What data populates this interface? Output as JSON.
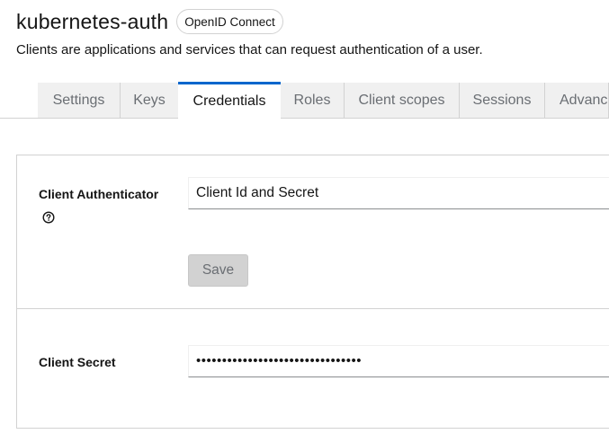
{
  "header": {
    "client_name": "kubernetes-auth",
    "protocol_badge": "OpenID Connect",
    "subtitle": "Clients are applications and services that can request authentication of a user."
  },
  "tabs": [
    {
      "label": "Settings",
      "active": false
    },
    {
      "label": "Keys",
      "active": false
    },
    {
      "label": "Credentials",
      "active": true
    },
    {
      "label": "Roles",
      "active": false
    },
    {
      "label": "Client scopes",
      "active": false
    },
    {
      "label": "Sessions",
      "active": false
    },
    {
      "label": "Advanced",
      "active": false
    }
  ],
  "credentials": {
    "client_authenticator": {
      "label": "Client Authenticator",
      "help_icon": "question-circle-icon",
      "value": "Client Id and Secret"
    },
    "save_label": "Save",
    "client_secret": {
      "label": "Client Secret",
      "value": "••••••••••••••••••••••••••••••••"
    }
  },
  "colors": {
    "active_tab_accent": "#0066cc",
    "inactive_tab_bg": "#f0f0f0",
    "border": "#d2d2d2",
    "disabled_button_bg": "#d2d2d2"
  }
}
